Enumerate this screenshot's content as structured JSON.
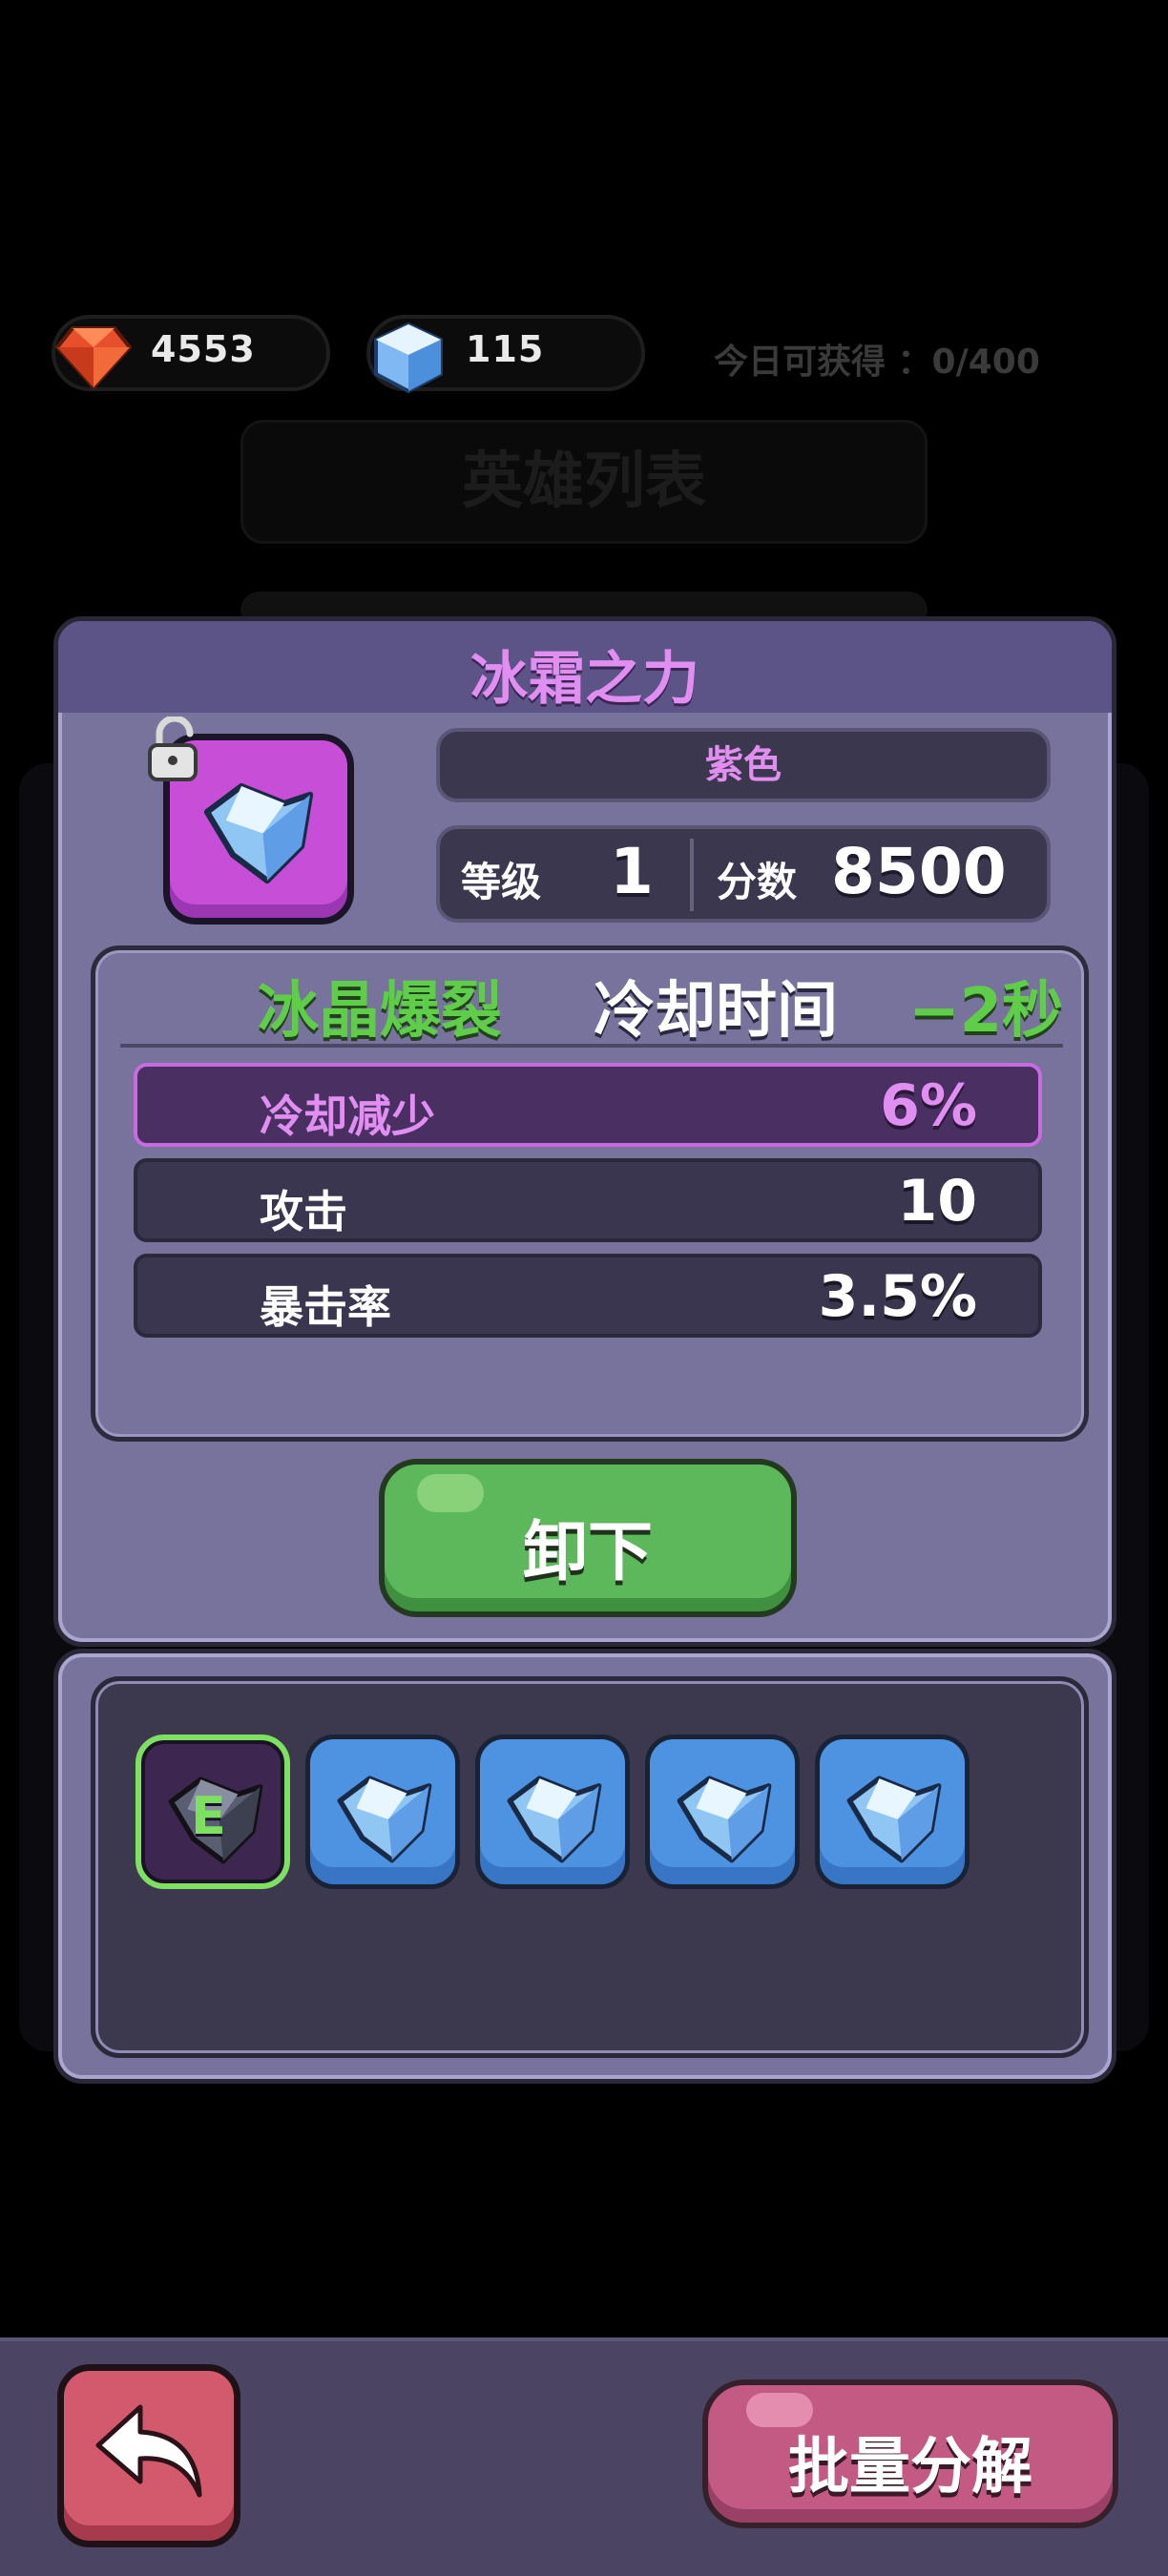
{
  "currency": {
    "gems": "4553",
    "crystals": "115",
    "daily_label": "今日可获得 ：0/400"
  },
  "background": {
    "title": "英雄列表"
  },
  "item": {
    "name": "冰霜之力",
    "rarity": "紫色",
    "level_label": "等级",
    "level": "1",
    "score_label": "分数",
    "score": "8500",
    "locked": false
  },
  "skill": {
    "name": "冰晶爆裂",
    "cooldown_label": "冷却时间",
    "cooldown_value": "−2秒"
  },
  "attributes": [
    {
      "label": "冷却减少",
      "value": "6%",
      "highlight": true
    },
    {
      "label": "攻击",
      "value": "10",
      "highlight": false
    },
    {
      "label": "暴击率",
      "value": "3.5%",
      "highlight": false
    }
  ],
  "buttons": {
    "unequip": "卸下",
    "batch_decompose": "批量分解"
  },
  "inventory": {
    "slots": [
      {
        "icon": "crystal-equipped-icon",
        "badge": "E",
        "equipped": true
      },
      {
        "icon": "crystal-icon",
        "equipped": false
      },
      {
        "icon": "crystal-icon",
        "equipped": false
      },
      {
        "icon": "crystal-icon",
        "equipped": false
      },
      {
        "icon": "crystal-icon",
        "equipped": false
      }
    ]
  },
  "colors": {
    "rarity_purple": "#e08ef0",
    "skill_green": "#5fcc4a",
    "panel": "#77739d"
  }
}
